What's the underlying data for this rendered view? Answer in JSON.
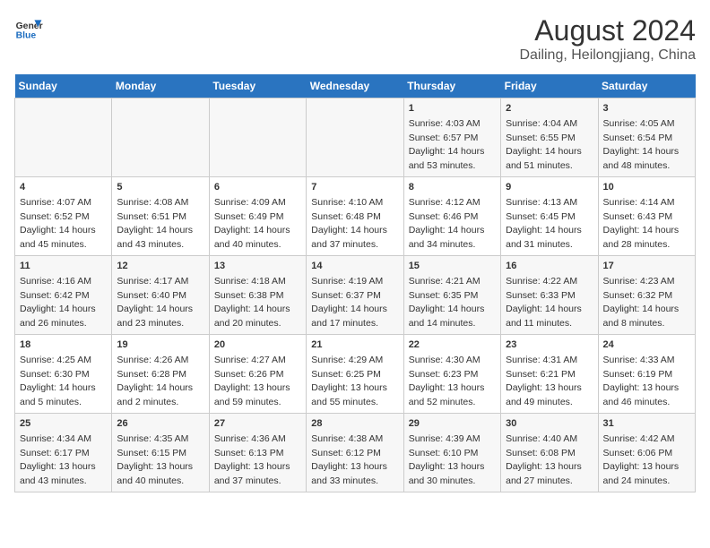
{
  "header": {
    "logo_line1": "General",
    "logo_line2": "Blue",
    "title": "August 2024",
    "subtitle": "Dailing, Heilongjiang, China"
  },
  "days_of_week": [
    "Sunday",
    "Monday",
    "Tuesday",
    "Wednesday",
    "Thursday",
    "Friday",
    "Saturday"
  ],
  "weeks": [
    [
      {
        "day": "",
        "info": ""
      },
      {
        "day": "",
        "info": ""
      },
      {
        "day": "",
        "info": ""
      },
      {
        "day": "",
        "info": ""
      },
      {
        "day": "1",
        "info": "Sunrise: 4:03 AM\nSunset: 6:57 PM\nDaylight: 14 hours\nand 53 minutes."
      },
      {
        "day": "2",
        "info": "Sunrise: 4:04 AM\nSunset: 6:55 PM\nDaylight: 14 hours\nand 51 minutes."
      },
      {
        "day": "3",
        "info": "Sunrise: 4:05 AM\nSunset: 6:54 PM\nDaylight: 14 hours\nand 48 minutes."
      }
    ],
    [
      {
        "day": "4",
        "info": "Sunrise: 4:07 AM\nSunset: 6:52 PM\nDaylight: 14 hours\nand 45 minutes."
      },
      {
        "day": "5",
        "info": "Sunrise: 4:08 AM\nSunset: 6:51 PM\nDaylight: 14 hours\nand 43 minutes."
      },
      {
        "day": "6",
        "info": "Sunrise: 4:09 AM\nSunset: 6:49 PM\nDaylight: 14 hours\nand 40 minutes."
      },
      {
        "day": "7",
        "info": "Sunrise: 4:10 AM\nSunset: 6:48 PM\nDaylight: 14 hours\nand 37 minutes."
      },
      {
        "day": "8",
        "info": "Sunrise: 4:12 AM\nSunset: 6:46 PM\nDaylight: 14 hours\nand 34 minutes."
      },
      {
        "day": "9",
        "info": "Sunrise: 4:13 AM\nSunset: 6:45 PM\nDaylight: 14 hours\nand 31 minutes."
      },
      {
        "day": "10",
        "info": "Sunrise: 4:14 AM\nSunset: 6:43 PM\nDaylight: 14 hours\nand 28 minutes."
      }
    ],
    [
      {
        "day": "11",
        "info": "Sunrise: 4:16 AM\nSunset: 6:42 PM\nDaylight: 14 hours\nand 26 minutes."
      },
      {
        "day": "12",
        "info": "Sunrise: 4:17 AM\nSunset: 6:40 PM\nDaylight: 14 hours\nand 23 minutes."
      },
      {
        "day": "13",
        "info": "Sunrise: 4:18 AM\nSunset: 6:38 PM\nDaylight: 14 hours\nand 20 minutes."
      },
      {
        "day": "14",
        "info": "Sunrise: 4:19 AM\nSunset: 6:37 PM\nDaylight: 14 hours\nand 17 minutes."
      },
      {
        "day": "15",
        "info": "Sunrise: 4:21 AM\nSunset: 6:35 PM\nDaylight: 14 hours\nand 14 minutes."
      },
      {
        "day": "16",
        "info": "Sunrise: 4:22 AM\nSunset: 6:33 PM\nDaylight: 14 hours\nand 11 minutes."
      },
      {
        "day": "17",
        "info": "Sunrise: 4:23 AM\nSunset: 6:32 PM\nDaylight: 14 hours\nand 8 minutes."
      }
    ],
    [
      {
        "day": "18",
        "info": "Sunrise: 4:25 AM\nSunset: 6:30 PM\nDaylight: 14 hours\nand 5 minutes."
      },
      {
        "day": "19",
        "info": "Sunrise: 4:26 AM\nSunset: 6:28 PM\nDaylight: 14 hours\nand 2 minutes."
      },
      {
        "day": "20",
        "info": "Sunrise: 4:27 AM\nSunset: 6:26 PM\nDaylight: 13 hours\nand 59 minutes."
      },
      {
        "day": "21",
        "info": "Sunrise: 4:29 AM\nSunset: 6:25 PM\nDaylight: 13 hours\nand 55 minutes."
      },
      {
        "day": "22",
        "info": "Sunrise: 4:30 AM\nSunset: 6:23 PM\nDaylight: 13 hours\nand 52 minutes."
      },
      {
        "day": "23",
        "info": "Sunrise: 4:31 AM\nSunset: 6:21 PM\nDaylight: 13 hours\nand 49 minutes."
      },
      {
        "day": "24",
        "info": "Sunrise: 4:33 AM\nSunset: 6:19 PM\nDaylight: 13 hours\nand 46 minutes."
      }
    ],
    [
      {
        "day": "25",
        "info": "Sunrise: 4:34 AM\nSunset: 6:17 PM\nDaylight: 13 hours\nand 43 minutes."
      },
      {
        "day": "26",
        "info": "Sunrise: 4:35 AM\nSunset: 6:15 PM\nDaylight: 13 hours\nand 40 minutes."
      },
      {
        "day": "27",
        "info": "Sunrise: 4:36 AM\nSunset: 6:13 PM\nDaylight: 13 hours\nand 37 minutes."
      },
      {
        "day": "28",
        "info": "Sunrise: 4:38 AM\nSunset: 6:12 PM\nDaylight: 13 hours\nand 33 minutes."
      },
      {
        "day": "29",
        "info": "Sunrise: 4:39 AM\nSunset: 6:10 PM\nDaylight: 13 hours\nand 30 minutes."
      },
      {
        "day": "30",
        "info": "Sunrise: 4:40 AM\nSunset: 6:08 PM\nDaylight: 13 hours\nand 27 minutes."
      },
      {
        "day": "31",
        "info": "Sunrise: 4:42 AM\nSunset: 6:06 PM\nDaylight: 13 hours\nand 24 minutes."
      }
    ]
  ]
}
